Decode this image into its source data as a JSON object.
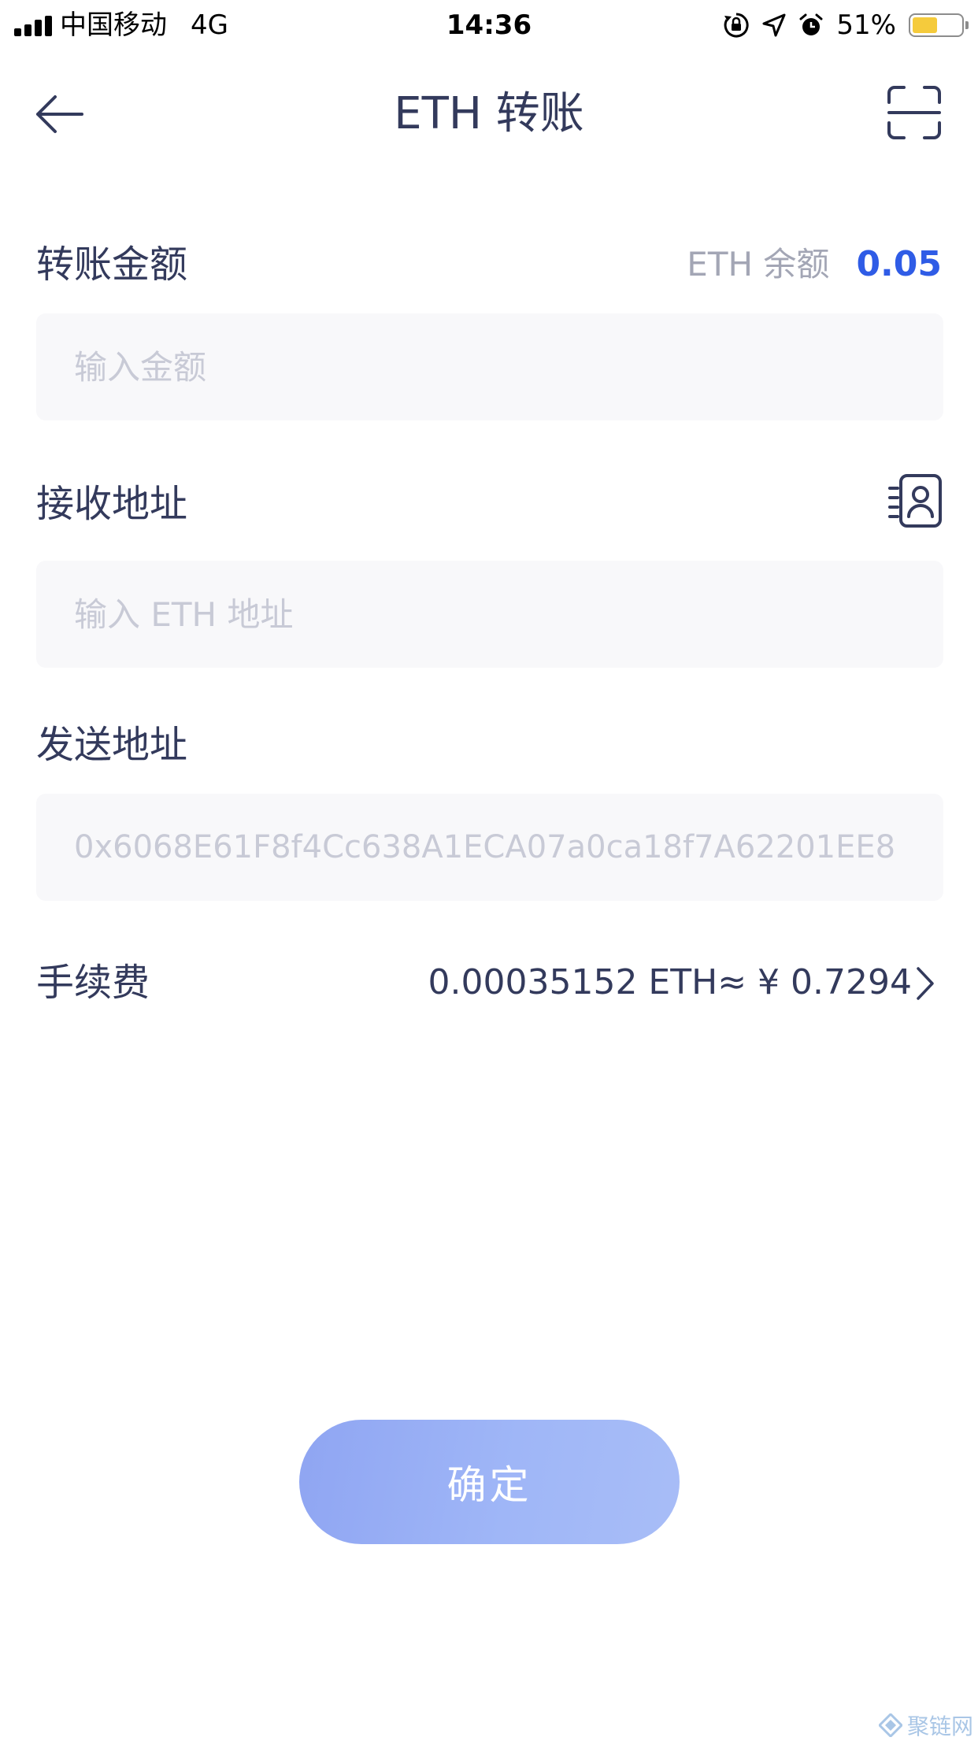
{
  "status_bar": {
    "carrier": "中国移动",
    "network": "4G",
    "time": "14:36",
    "battery_percent": "51%",
    "battery_level": 0.51,
    "battery_color": "#f5cb3c",
    "icons": [
      "signal-bars-icon",
      "rotation-lock-icon",
      "location-arrow-icon",
      "alarm-clock-icon",
      "battery-icon"
    ]
  },
  "nav": {
    "title": "ETH 转账",
    "back_icon": "arrow-left-icon",
    "scan_icon": "scan-frame-icon"
  },
  "amount": {
    "label": "转账金额",
    "balance_label": "ETH 余额",
    "balance_value": "0.05",
    "placeholder": "输入金额"
  },
  "receive": {
    "label": "接收地址",
    "placeholder": "输入 ETH 地址",
    "contacts_icon": "address-book-icon"
  },
  "send": {
    "label": "发送地址",
    "address": "0x6068E61F8f4Cc638A1ECA07a0ca18f7A62201EE8"
  },
  "fee": {
    "label": "手续费",
    "value": "0.00035152 ETH≈ ¥ 0.7294",
    "chevron_icon": "chevron-right-icon"
  },
  "confirm": {
    "label": "确定"
  },
  "watermark": {
    "text": "聚链网",
    "icon": "diamond-logo-icon"
  },
  "colors": {
    "accent": "#2f5ce6",
    "text_primary": "#333a5c",
    "text_muted": "#a3a6b5",
    "placeholder": "#c8cad6",
    "field_bg": "#f8f8fa",
    "button_gradient_start": "#8fa5f2",
    "button_gradient_end": "#a8bdf7"
  }
}
